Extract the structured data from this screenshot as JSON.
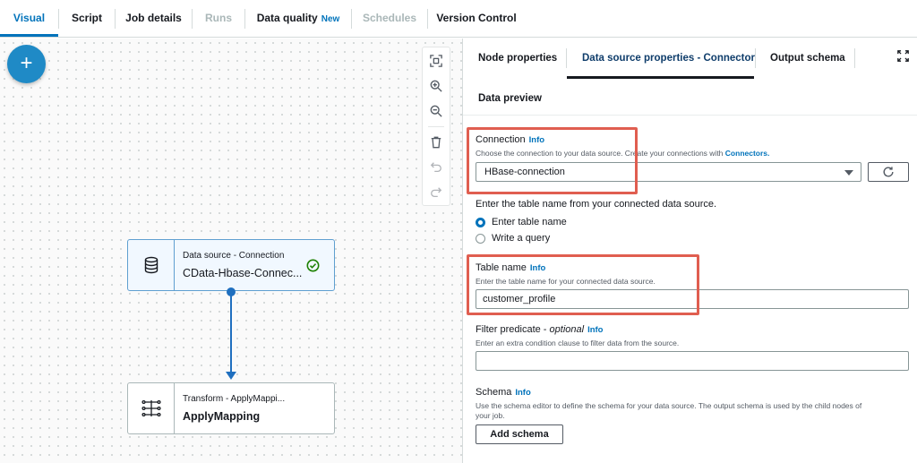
{
  "tabs": [
    {
      "label": "Visual"
    },
    {
      "label": "Script"
    },
    {
      "label": "Job details"
    },
    {
      "label": "Runs"
    },
    {
      "label": "Data quality",
      "badge": "New"
    },
    {
      "label": "Schedules"
    },
    {
      "label": "Version Control"
    }
  ],
  "canvas": {
    "add_label": "+",
    "nodes": [
      {
        "type": "Data source - Connection",
        "name": "CData-Hbase-Connec...",
        "selected": true
      },
      {
        "type": "Transform - ApplyMappi...",
        "name": "ApplyMapping"
      }
    ]
  },
  "panel": {
    "tabs": {
      "node_properties": "Node properties",
      "data_source": "Data source properties - Connector",
      "output_schema": "Output schema",
      "data_preview": "Data preview"
    },
    "connection": {
      "label": "Connection",
      "info": "Info",
      "desc_prefix": "Choose the connection to your data source. Create your connections with",
      "desc_link": "Connectors.",
      "value": "HBase-connection"
    },
    "table_source": {
      "prompt": "Enter the table name from your connected data source.",
      "options": [
        "Enter table name",
        "Write a query"
      ],
      "selected": "Enter table name"
    },
    "table_name": {
      "label": "Table name",
      "info": "Info",
      "desc": "Enter the table name for your connected data source.",
      "value": "customer_profile"
    },
    "filter": {
      "label": "Filter predicate - ",
      "optional": "optional",
      "info": "Info",
      "desc": "Enter an extra condition clause to filter data from the source.",
      "value": ""
    },
    "schema": {
      "label": "Schema",
      "info": "Info",
      "desc_line1": "Use the schema editor to define the schema for your data source. The output schema is used by the child nodes of",
      "desc_line2": "your job.",
      "button": "Add schema"
    }
  },
  "colors": {
    "accent": "#0073bb",
    "highlight": "#e05e50",
    "add_button": "#1f8ac6",
    "success": "#1d8102"
  }
}
